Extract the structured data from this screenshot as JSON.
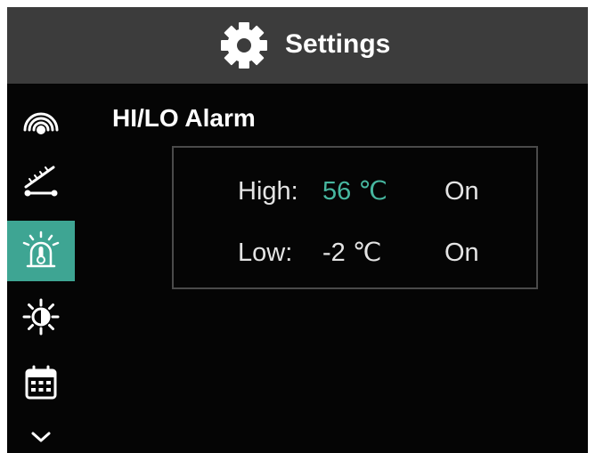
{
  "header": {
    "title": "Settings",
    "icon": "gear-icon"
  },
  "sidebar": {
    "active_index": 2,
    "active_color": "#3ea593",
    "items": [
      {
        "name": "signal",
        "icon": "wireless-signal-icon"
      },
      {
        "name": "probe",
        "icon": "probe-calibration-icon"
      },
      {
        "name": "alarm",
        "icon": "alarm-thermometer-icon"
      },
      {
        "name": "brightness",
        "icon": "brightness-icon"
      },
      {
        "name": "calendar",
        "icon": "calendar-icon"
      }
    ],
    "more_icon": "chevron-down-icon"
  },
  "page": {
    "title": "HI/LO Alarm",
    "high": {
      "label": "High:",
      "value": "56 ℃",
      "state": "On",
      "value_color": "#47b7a0"
    },
    "low": {
      "label": "Low:",
      "value": "-2 ℃",
      "state": "On"
    }
  }
}
